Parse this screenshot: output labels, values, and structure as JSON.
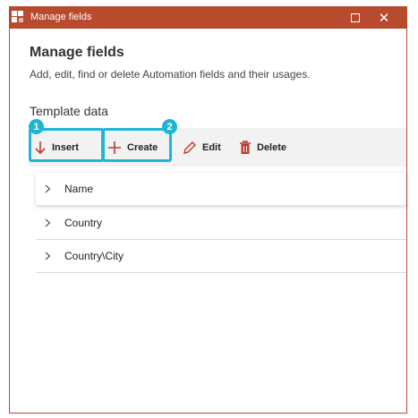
{
  "window": {
    "title": "Manage fields"
  },
  "header": {
    "heading": "Manage fields",
    "subtitle": "Add, edit, find or delete Automation fields and their usages."
  },
  "section": {
    "title": "Template data"
  },
  "toolbar": {
    "insert_label": "Insert",
    "create_label": "Create",
    "edit_label": "Edit",
    "delete_label": "Delete"
  },
  "callouts": [
    "1",
    "2"
  ],
  "fields": [
    {
      "label": "Name"
    },
    {
      "label": "Country"
    },
    {
      "label": "Country\\City"
    }
  ],
  "colors": {
    "titlebar": "#b84a2e",
    "accent_icon": "#c0392b",
    "highlight": "#1fb6d6"
  },
  "icons": {
    "app": "app-logo-icon",
    "maximize": "maximize-icon",
    "close": "close-icon",
    "insert": "arrow-down-icon",
    "create": "plus-icon",
    "edit": "pencil-icon",
    "delete": "trash-icon",
    "expand": "chevron-right-icon"
  }
}
